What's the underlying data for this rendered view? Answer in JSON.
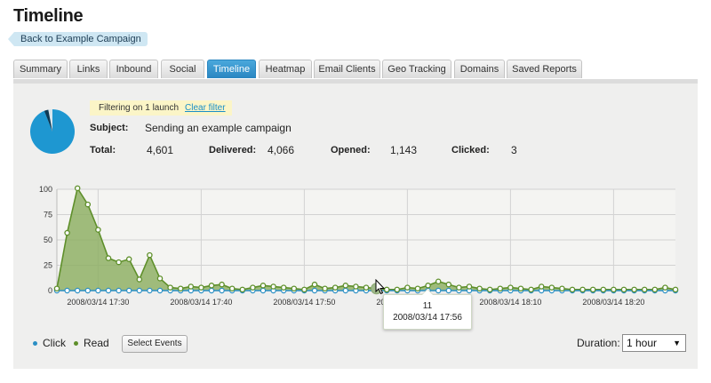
{
  "page": {
    "title": "Timeline",
    "back_label": "Back to Example Campaign"
  },
  "tabs": [
    {
      "label": "Summary",
      "active": false
    },
    {
      "label": "Links",
      "active": false
    },
    {
      "label": "Inbound",
      "active": false
    },
    {
      "label": "Social",
      "active": false
    },
    {
      "label": "Timeline",
      "active": true
    },
    {
      "label": "Heatmap",
      "active": false
    },
    {
      "label": "Email Clients",
      "active": false
    },
    {
      "label": "Geo Tracking",
      "active": false
    },
    {
      "label": "Domains",
      "active": false
    },
    {
      "label": "Saved Reports",
      "active": false
    }
  ],
  "filter": {
    "text": "Filtering on 1 launch",
    "clear_label": "Clear filter"
  },
  "summary": {
    "subject_label": "Subject:",
    "subject": "Sending an example campaign",
    "total_label": "Total:",
    "total": "4,601",
    "delivered_label": "Delivered:",
    "delivered": "4,066",
    "opened_label": "Opened:",
    "opened": "1,143",
    "clicked_label": "Clicked:",
    "clicked": "3"
  },
  "pie": {
    "opened_fraction": 0.94,
    "colors": {
      "main": "#1e97d1",
      "slice": "#0d3a55",
      "rest": "#d9e6ee"
    }
  },
  "chart_data": {
    "type": "area",
    "yticks": [
      0,
      25,
      50,
      75,
      100
    ],
    "ylim": [
      0,
      100
    ],
    "xticklabels": [
      "2008/03/14 17:30",
      "2008/03/14 17:40",
      "2008/03/14 17:50",
      "2008/03/14 18:00",
      "2008/03/14 18:10",
      "2008/03/14 18:20"
    ],
    "xtick_positions": [
      4,
      14,
      24,
      34,
      44,
      54
    ],
    "x_count": 61,
    "grid": true,
    "series": [
      {
        "name": "Read",
        "color": "#5e8f2a",
        "fill": "#8fb066",
        "values": [
          2,
          57,
          101,
          85,
          60,
          32,
          28,
          31,
          11,
          35,
          12,
          3,
          2,
          4,
          3,
          5,
          6,
          2,
          1,
          3,
          5,
          4,
          3,
          2,
          1,
          6,
          2,
          3,
          5,
          4,
          3,
          2,
          1,
          1,
          3,
          2,
          5,
          9,
          6,
          3,
          4,
          2,
          1,
          2,
          3,
          2,
          1,
          4,
          3,
          2,
          1,
          1,
          1,
          1,
          1,
          1,
          1,
          1,
          1,
          3,
          1
        ]
      },
      {
        "name": "Click",
        "color": "#2b8fc4",
        "values": [
          0,
          0,
          0,
          0,
          0,
          0,
          0,
          0,
          0,
          0,
          0,
          0,
          0,
          0,
          0,
          0,
          0,
          0,
          0,
          0,
          0,
          0,
          0,
          0,
          0,
          0,
          0,
          0,
          0,
          0,
          0,
          0,
          0,
          0,
          0,
          0,
          0,
          0,
          0,
          0,
          0,
          0,
          0,
          0,
          0,
          0,
          0,
          0,
          0,
          0,
          0,
          0,
          0,
          0,
          0,
          0,
          0,
          0,
          0,
          0,
          0
        ]
      }
    ],
    "highlight_index": 31,
    "tooltip": {
      "value": "11",
      "date": "2008/03/14 17:56"
    }
  },
  "legend": {
    "click_label": "Click",
    "read_label": "Read",
    "click_color": "#2b8fc4",
    "read_color": "#5e8f2a"
  },
  "controls": {
    "select_events_label": "Select Events",
    "duration_label": "Duration:",
    "duration_value": "1 hour"
  }
}
